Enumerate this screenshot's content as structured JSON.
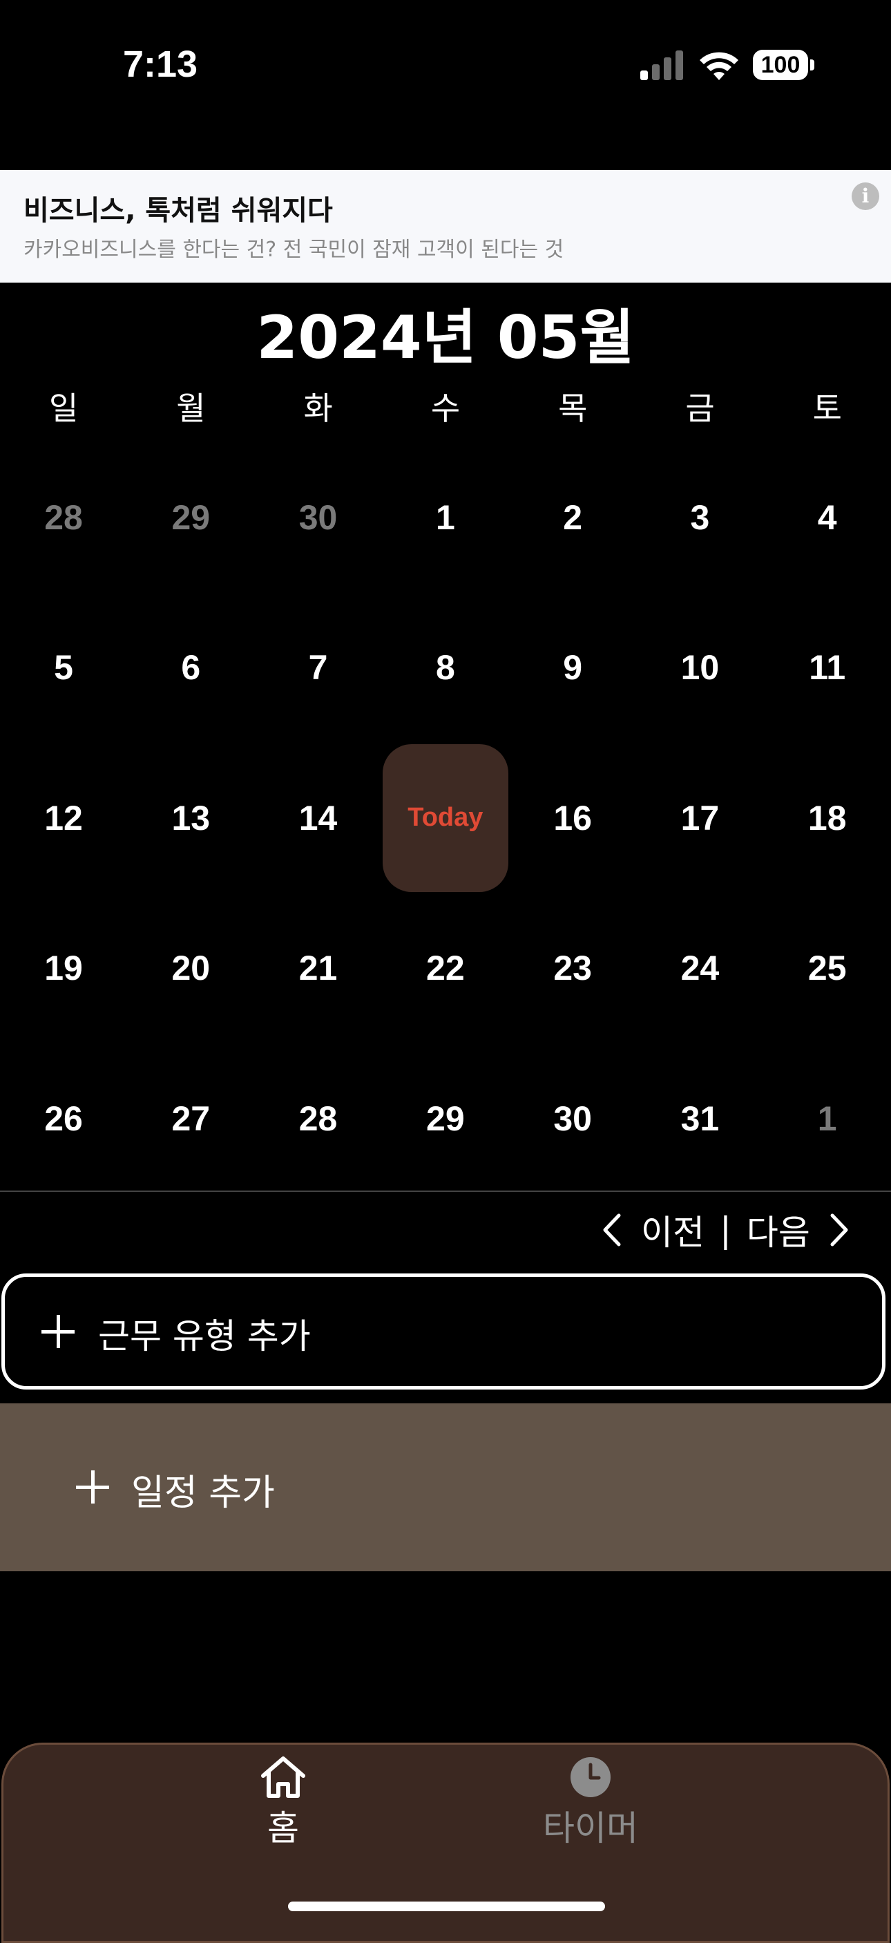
{
  "status_bar": {
    "time": "7:13",
    "battery": "100"
  },
  "ad_banner": {
    "title": "비즈니스, 톡처럼 쉬워지다",
    "description": "카카오비즈니스를 한다는 건? 전 국민이 잠재 고객이 된다는 것",
    "info_icon": "info-icon"
  },
  "calendar": {
    "month_title": "2024년 05월",
    "weekdays": [
      "일",
      "월",
      "화",
      "수",
      "목",
      "금",
      "토"
    ],
    "weeks": [
      [
        {
          "label": "28",
          "muted": true
        },
        {
          "label": "29",
          "muted": true
        },
        {
          "label": "30",
          "muted": true
        },
        {
          "label": "1"
        },
        {
          "label": "2"
        },
        {
          "label": "3"
        },
        {
          "label": "4"
        }
      ],
      [
        {
          "label": "5"
        },
        {
          "label": "6"
        },
        {
          "label": "7"
        },
        {
          "label": "8"
        },
        {
          "label": "9"
        },
        {
          "label": "10"
        },
        {
          "label": "11"
        }
      ],
      [
        {
          "label": "12"
        },
        {
          "label": "13"
        },
        {
          "label": "14"
        },
        {
          "label": "Today",
          "today": true
        },
        {
          "label": "16"
        },
        {
          "label": "17"
        },
        {
          "label": "18"
        }
      ],
      [
        {
          "label": "19"
        },
        {
          "label": "20"
        },
        {
          "label": "21"
        },
        {
          "label": "22"
        },
        {
          "label": "23"
        },
        {
          "label": "24"
        },
        {
          "label": "25"
        }
      ],
      [
        {
          "label": "26"
        },
        {
          "label": "27"
        },
        {
          "label": "28"
        },
        {
          "label": "29"
        },
        {
          "label": "30"
        },
        {
          "label": "31"
        },
        {
          "label": "1",
          "muted": true
        }
      ]
    ]
  },
  "navigation": {
    "prev_label": "이전",
    "separator": "|",
    "next_label": "다음"
  },
  "actions": {
    "add_worktype_label": "근무 유형 추가",
    "add_schedule_label": "일정 추가"
  },
  "tab_bar": {
    "home_label": "홈",
    "timer_label": "타이머"
  },
  "colors": {
    "today_bg": "#3e2a23",
    "today_text": "#e04a35",
    "schedule_bg": "#625448",
    "tabbar_bg": "#3b2821",
    "muted_day": "#7a7a7a"
  }
}
